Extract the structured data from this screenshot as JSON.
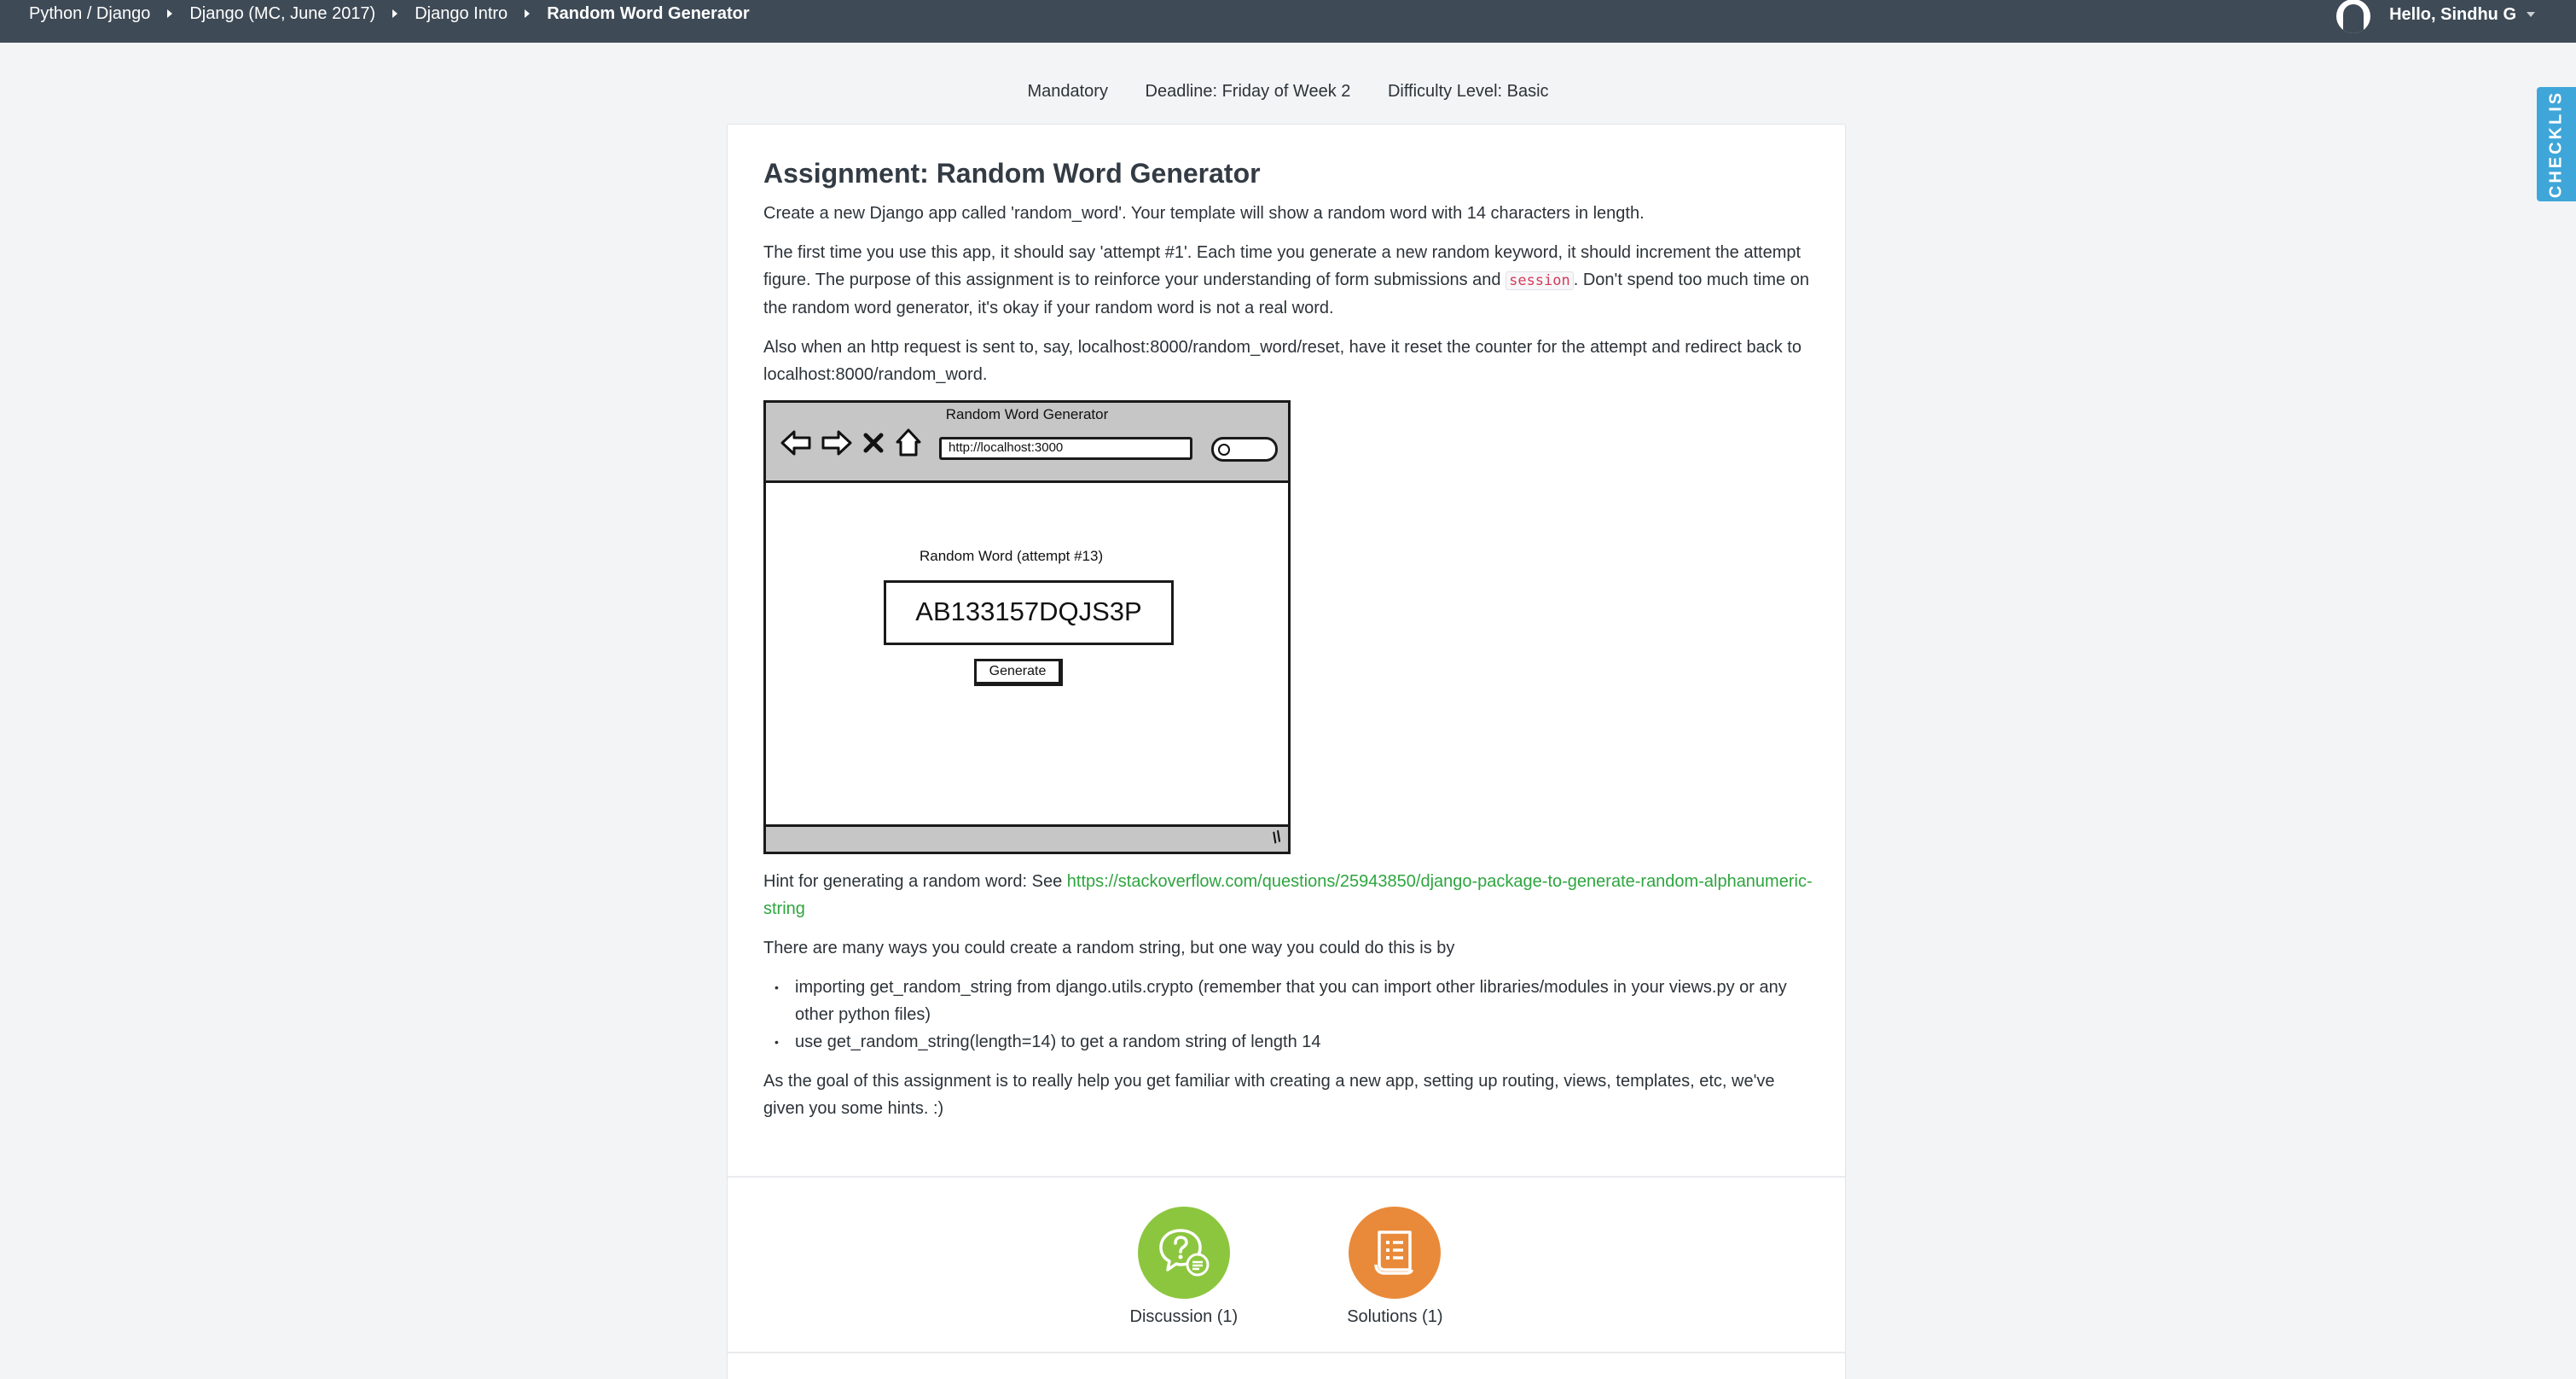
{
  "breadcrumb": {
    "items": [
      "Python / Django",
      "Django (MC, June 2017)",
      "Django Intro"
    ],
    "current": "Random Word Generator"
  },
  "user": {
    "greeting": "Hello, Sindhu G"
  },
  "checklist": {
    "label": "CHECKLIS"
  },
  "meta": {
    "type": "Mandatory",
    "deadline": "Deadline: Friday of Week 2",
    "difficulty": "Difficulty Level: Basic"
  },
  "assignment": {
    "title": "Assignment: Random Word Generator",
    "intro": "Create a new Django app called 'random_word'. Your template will show a random word with 14 characters in length.",
    "para2_before": "The first time you use this app, it should say 'attempt #1'. Each time you generate a new random keyword, it should increment the attempt figure. The purpose of this assignment is to reinforce your understanding of form submissions and ",
    "para2_code": "session",
    "para2_after": ". Don't spend too much time on the random word generator, it's okay if your random word is not a real word.",
    "para3": "Also when an http request is sent to, say, localhost:8000/random_word/reset, have it reset the counter for the attempt and redirect back to localhost:8000/random_word.",
    "hint_text": "Hint for generating a random word: See ",
    "hint_link": "https://stackoverflow.com/questions/25943850/django-package-to-generate-random-alphanumeric-string",
    "ways_text": "There are many ways you could create a random string, but one way you could do this is by",
    "bullets": [
      "importing get_random_string from django.utils.crypto (remember that you can import other libraries/modules in your views.py or any other python files)",
      "use get_random_string(length=14) to get a random string of length 14"
    ],
    "closing": "As the goal of this assignment is to really help you get familiar with creating a new app, setting up routing, views, templates, etc, we've given you some hints. :)"
  },
  "mockup": {
    "window_title": "Random Word Generator",
    "url": "http://localhost:3000",
    "label": "Random Word (attempt #13)",
    "word": "AB133157DQJS3P",
    "button": "Generate"
  },
  "actions": {
    "discussion": "Discussion (1)",
    "solutions": "Solutions (1)"
  },
  "colors": {
    "topbar": "#3e4a56",
    "link": "#2ea53f",
    "discussion": "#8cc63f",
    "solutions": "#e98a3a",
    "checklist": "#3fa6d9"
  }
}
